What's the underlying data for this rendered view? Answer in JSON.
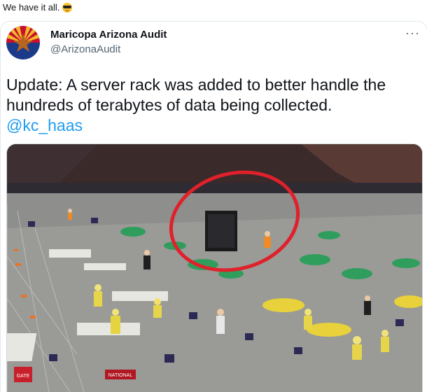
{
  "intro": {
    "text": "We have it all.",
    "emoji_icon": "smiling-face-with-sunglasses-icon"
  },
  "tweet": {
    "author_name": "Maricopa Arizona Audit",
    "author_handle": "@ArizonaAudit",
    "more_label": "···",
    "text_line1": "Update: A server rack was added to better handle the",
    "text_line2": "hundreds of terabytes of data being collected.",
    "mention": "@kc_haas"
  },
  "media": {
    "gate_label": "GATE",
    "sign_label": "NATIONAL",
    "circle_color": "#e0202a"
  }
}
